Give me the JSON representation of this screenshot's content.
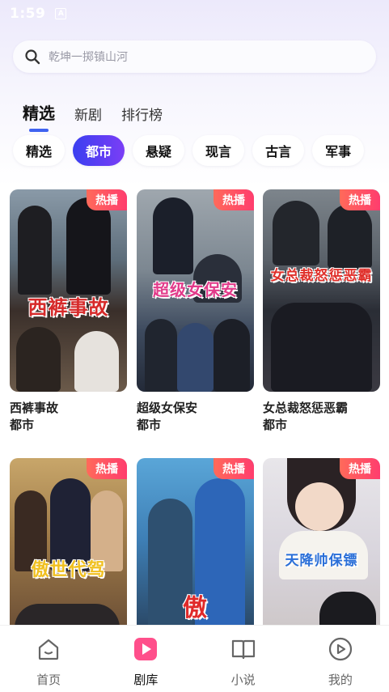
{
  "status_bar": {
    "time": "1:59",
    "indicator": "A"
  },
  "search": {
    "placeholder": "乾坤一掷镇山河"
  },
  "top_tabs": [
    {
      "label": "精选",
      "active": true
    },
    {
      "label": "新剧",
      "active": false
    },
    {
      "label": "排行榜",
      "active": false
    }
  ],
  "categories": [
    {
      "label": "精选",
      "active": false
    },
    {
      "label": "都市",
      "active": true
    },
    {
      "label": "悬疑",
      "active": false
    },
    {
      "label": "现言",
      "active": false
    },
    {
      "label": "古言",
      "active": false
    },
    {
      "label": "军事",
      "active": false
    }
  ],
  "dramas": [
    {
      "title": "西裤事故",
      "genre": "都市",
      "badge": "热播",
      "poster_text": "西裤事故"
    },
    {
      "title": "超级女保安",
      "genre": "都市",
      "badge": "热播",
      "poster_text": "超级女保安"
    },
    {
      "title": "女总裁怒惩恶霸",
      "genre": "都市",
      "badge": "热播",
      "poster_text": "女总裁怒惩恶霸"
    },
    {
      "title": "",
      "genre": "",
      "badge": "热播",
      "poster_text": "傲世代驾"
    },
    {
      "title": "",
      "genre": "",
      "badge": "热播",
      "poster_text": "傲"
    },
    {
      "title": "",
      "genre": "",
      "badge": "热播",
      "poster_text": "天降帅保镖"
    }
  ],
  "bottom_nav": [
    {
      "label": "首页",
      "icon": "home-icon",
      "active": false
    },
    {
      "label": "剧库",
      "icon": "play-library-icon",
      "active": true
    },
    {
      "label": "小说",
      "icon": "book-icon",
      "active": false
    },
    {
      "label": "我的",
      "icon": "profile-play-icon",
      "active": false
    }
  ],
  "colors": {
    "accent": "#3f62f0",
    "chip_gradient_start": "#3a3ff0",
    "chip_gradient_end": "#7b3ef6",
    "badge": "#ff4d62",
    "library_icon": "#ff4f8b"
  }
}
